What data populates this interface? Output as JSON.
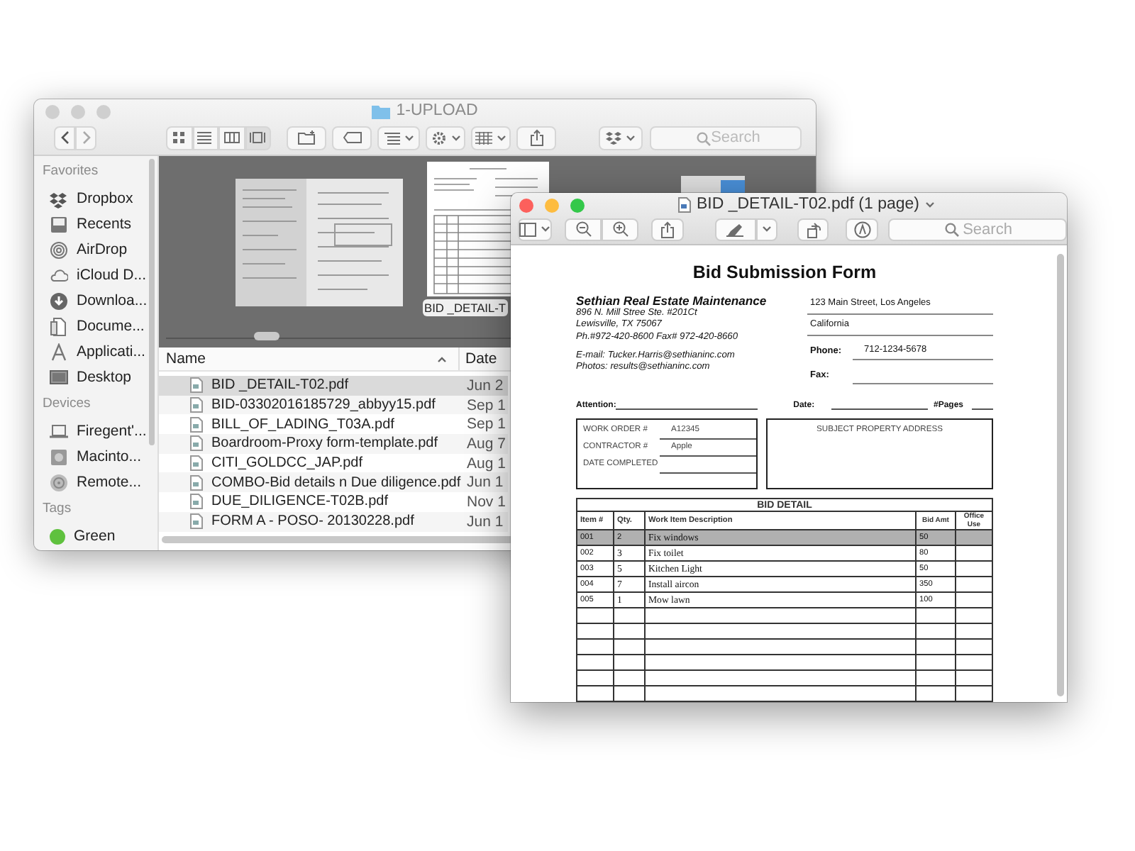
{
  "finder": {
    "title": "1-UPLOAD",
    "view_modes": [
      {
        "selected": false
      },
      {
        "selected": false
      },
      {
        "selected": false
      },
      {
        "selected": true
      }
    ],
    "search": {
      "placeholder": "Search"
    },
    "sidebar": [
      {
        "heading": "Favorites",
        "items": [
          {
            "label": "Dropbox"
          },
          {
            "label": "Recents"
          },
          {
            "label": "AirDrop"
          },
          {
            "label": "iCloud D..."
          },
          {
            "label": "Downloa..."
          },
          {
            "label": "Docume..."
          },
          {
            "label": "Applicati..."
          },
          {
            "label": "Desktop"
          }
        ]
      },
      {
        "heading": "Devices",
        "items": [
          {
            "label": "Firegent'..."
          },
          {
            "label": "Macinto..."
          },
          {
            "label": "Remote..."
          }
        ]
      },
      {
        "heading": "Tags",
        "items": [
          {
            "label": "Green",
            "color": "#5fc13e"
          }
        ]
      }
    ],
    "gallery": {
      "label": "BID _DETAIL-T"
    },
    "columns": [
      "Name",
      "Date"
    ],
    "files": [
      {
        "name": "BID _DETAIL-T02.pdf",
        "date": "Jun 2",
        "selected": true
      },
      {
        "name": "BID-03302016185729_abbyy15.pdf",
        "date": "Sep 1",
        "selected": false
      },
      {
        "name": "BILL_OF_LADING_T03A.pdf",
        "date": "Sep 1",
        "selected": false
      },
      {
        "name": "Boardroom-Proxy form-template.pdf",
        "date": "Aug 7",
        "selected": false
      },
      {
        "name": "CITI_GOLDCC_JAP.pdf",
        "date": "Aug 1",
        "selected": false
      },
      {
        "name": "COMBO-Bid details n Due diligence.pdf",
        "date": "Jun 1",
        "selected": false
      },
      {
        "name": "DUE_DILIGENCE-T02B.pdf",
        "date": "Nov 1",
        "selected": false
      },
      {
        "name": "FORM A - POSO- 20130228.pdf",
        "date": "Jun 1",
        "selected": false
      }
    ]
  },
  "preview": {
    "title": "BID _DETAIL-T02.pdf (1 page)",
    "search": {
      "placeholder": "Search"
    },
    "document": {
      "title": "Bid Submission Form",
      "company": "Sethian Real Estate Maintenance",
      "company_lines": [
        "896 N. Mill Stree Ste. #201Ct",
        "Lewisville, TX 75067",
        "Ph.#972-420-8600 Fax# 972-420-8660"
      ],
      "contact_lines": [
        "E-mail: Tucker.Harris@sethianinc.com",
        "Photos: results@sethianinc.com"
      ],
      "address_lines": [
        "123 Main Street, Los Angeles",
        "California"
      ],
      "phone": {
        "label": "Phone:",
        "value": "712-1234-5678"
      },
      "fax": {
        "label": "Fax:"
      },
      "attention_label": "Attention:",
      "date_label": "Date:",
      "pages_label": "#Pages",
      "work_fields": [
        {
          "label": "WORK ORDER #",
          "value": "A12345"
        },
        {
          "label": "CONTRACTOR #",
          "value": "Apple"
        },
        {
          "label": "DATE COMPLETED"
        }
      ],
      "subject_label": "SUBJECT PROPERTY ADDRESS",
      "bid_detail": {
        "title": "BID DETAIL",
        "columns": [
          "Item #",
          "Qty.",
          "Work Item Description",
          "Bid Amt",
          "Office Use"
        ],
        "rows": [
          {
            "item": "001",
            "qty": "2",
            "description": "Fix windows",
            "amount": "50",
            "selected": true
          },
          {
            "item": "002",
            "qty": "3",
            "description": "Fix toilet",
            "amount": "80",
            "selected": false
          },
          {
            "item": "003",
            "qty": "5",
            "description": "Kitchen Light",
            "amount": "50",
            "selected": false
          },
          {
            "item": "004",
            "qty": "7",
            "description": "Install aircon",
            "amount": "350",
            "selected": false
          },
          {
            "item": "005",
            "qty": "1",
            "description": "Mow lawn",
            "amount": "100",
            "selected": false
          }
        ]
      }
    }
  }
}
